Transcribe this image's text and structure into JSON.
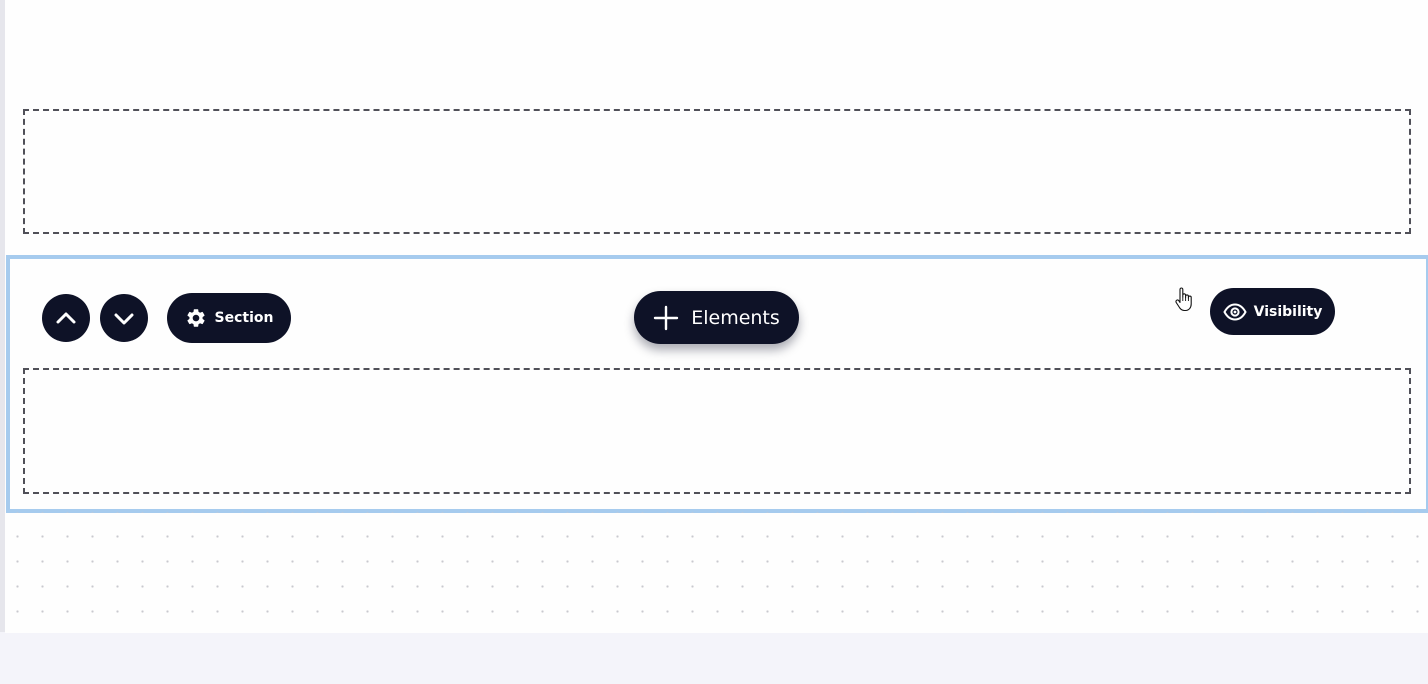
{
  "toolbar": {
    "move_up_icon": "chevron-up-icon",
    "move_down_icon": "chevron-down-icon",
    "section_label": "Section",
    "section_icon": "gear-icon",
    "elements_label": "Elements",
    "elements_icon": "plus-icon",
    "visibility_label": "Visibility",
    "visibility_icon": "eye-icon"
  },
  "colors": {
    "button_bg": "#0e1227",
    "selection_border": "#a6cbee",
    "page_bg": "#f4f4fa",
    "canvas_bg": "#fefefe"
  }
}
